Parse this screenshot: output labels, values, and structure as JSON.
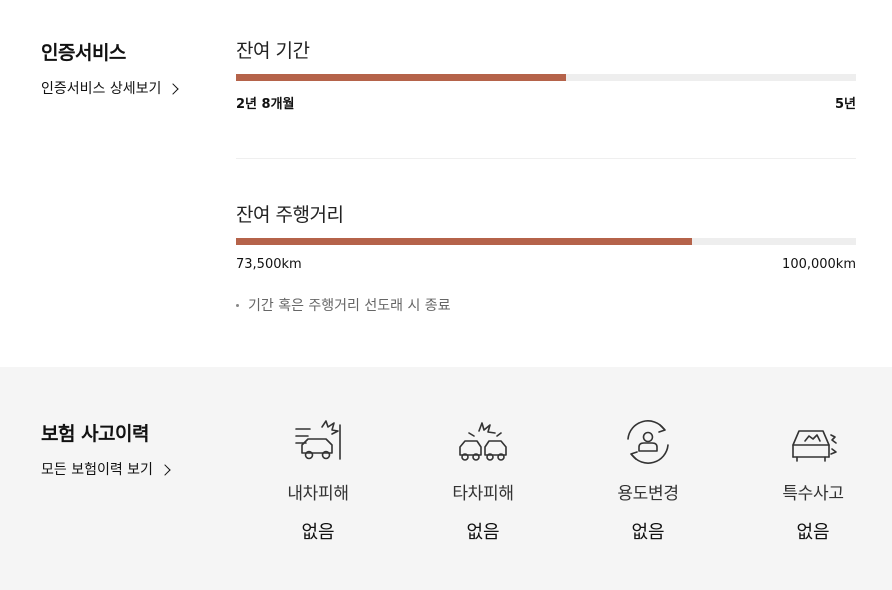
{
  "certification": {
    "title": "인증서비스",
    "link_label": "인증서비스 상세보기"
  },
  "remaining_period": {
    "title": "잔여 기간",
    "progress": 0.532,
    "current_label": "2년 8개월",
    "max_label": "5년"
  },
  "remaining_mileage": {
    "title": "잔여 주행거리",
    "progress": 0.735,
    "current_label": "73,500km",
    "max_label": "100,000km"
  },
  "note": "기간 혹은 주행거리 선도래 시 종료",
  "insurance": {
    "title": "보험 사고이력",
    "link_label": "모든 보험이력 보기",
    "items": [
      {
        "icon": "own-car-damage-icon",
        "label": "내차피해",
        "value": "없음"
      },
      {
        "icon": "other-car-damage-icon",
        "label": "타차피해",
        "value": "없음"
      },
      {
        "icon": "usage-change-icon",
        "label": "용도변경",
        "value": "없음"
      },
      {
        "icon": "special-accident-icon",
        "label": "특수사고",
        "value": "없음"
      }
    ]
  },
  "colors": {
    "accent": "#b5634a",
    "track": "#eeeeee",
    "section_bg": "#f5f5f5"
  }
}
